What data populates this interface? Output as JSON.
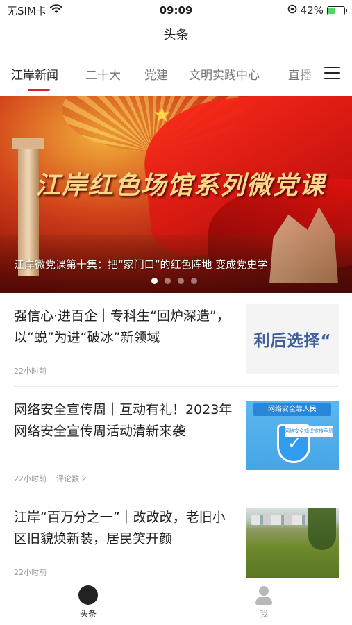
{
  "status_bar": {
    "carrier": "无SIM卡",
    "time": "09:09",
    "battery": "42%"
  },
  "header": {
    "title": "头条"
  },
  "tabs": [
    {
      "label": "江岸新闻",
      "active": true
    },
    {
      "label": "二十大",
      "active": false
    },
    {
      "label": "党建",
      "active": false
    },
    {
      "label": "文明实践中心",
      "active": false
    },
    {
      "label": "直播",
      "active": false
    }
  ],
  "banner": {
    "title": "江岸红色场馆系列微党课",
    "caption": "江岸微党课第十集：把“家门口”的红色阵地 变成党史学",
    "slide_count": 4,
    "active_slide": 1
  },
  "news": [
    {
      "title": "强信心·进百企｜专科生“回炉深造”，以“蜕”为进“破冰”新领域",
      "time": "22小时前",
      "comments": "",
      "thumb_text": "利后选择“"
    },
    {
      "title": "网络安全宣传周｜互动有礼！2023年网络安全宣传周活动清新来袭",
      "time": "22小时前",
      "comments": "评论数 2",
      "thumb_text": "网络安全靠人民",
      "thumb_subtext": "网络安全知识宣传手册"
    },
    {
      "title": "江岸“百万分之一”｜改改改，老旧小区旧貌焕新装，居民笑开颜",
      "time": "22小时前",
      "comments": ""
    }
  ],
  "tabbar": {
    "home": "头条",
    "me": "我"
  },
  "colors": {
    "accent": "#d9261c",
    "active_tab_text": "#222222",
    "inactive_tab_text": "#777777"
  }
}
